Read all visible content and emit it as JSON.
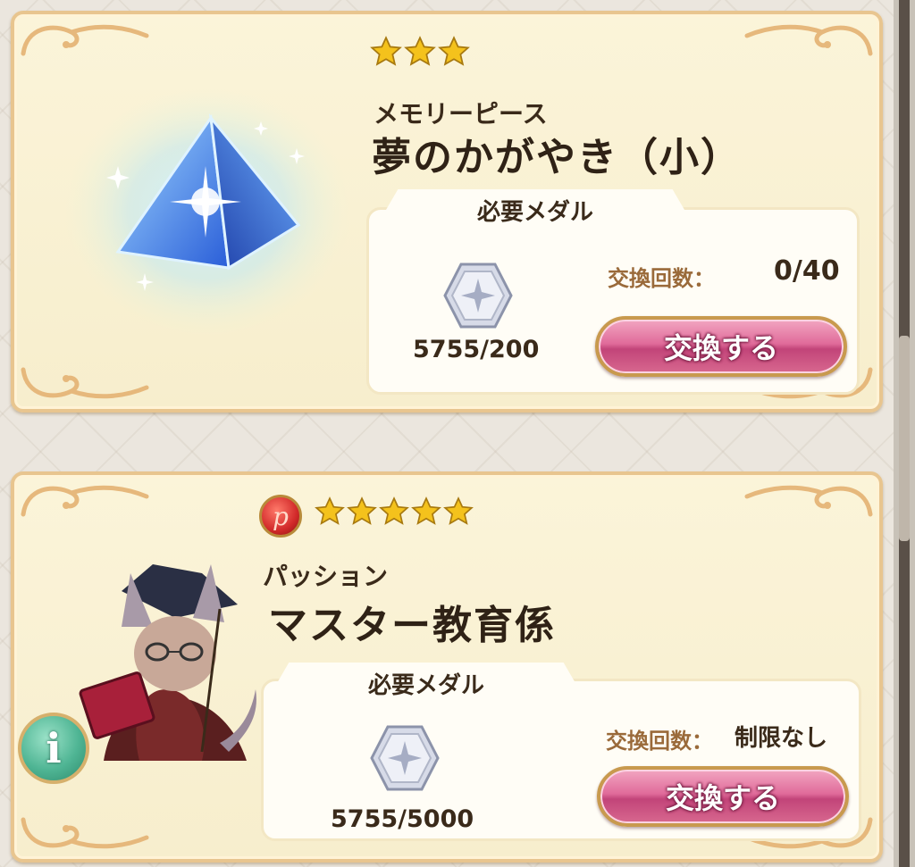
{
  "items": [
    {
      "stars": 3,
      "category": "メモリーピース",
      "name": "夢のかがやき（小）",
      "medal_header": "必要メダル",
      "medal_count": "5755/200",
      "exchange_label": "交換回数：",
      "exchange_value": "0/40",
      "button_label": "交換する",
      "image": "blue-crystal-pyramid"
    },
    {
      "stars": 5,
      "attribute_badge": "p",
      "category": "パッション",
      "name": "マスター教育係",
      "medal_header": "必要メダル",
      "medal_count": "5755/5000",
      "exchange_label": "交換回数：",
      "exchange_value": "制限なし",
      "button_label": "交換する",
      "image": "fox-professor-character"
    }
  ],
  "info_button": "i",
  "colors": {
    "card_bg": "#f9f1d3",
    "card_border": "#e8c58f",
    "button_pink": "#e06b9a",
    "star_gold": "#f4c21c",
    "label_brown": "#9a6a3a"
  }
}
